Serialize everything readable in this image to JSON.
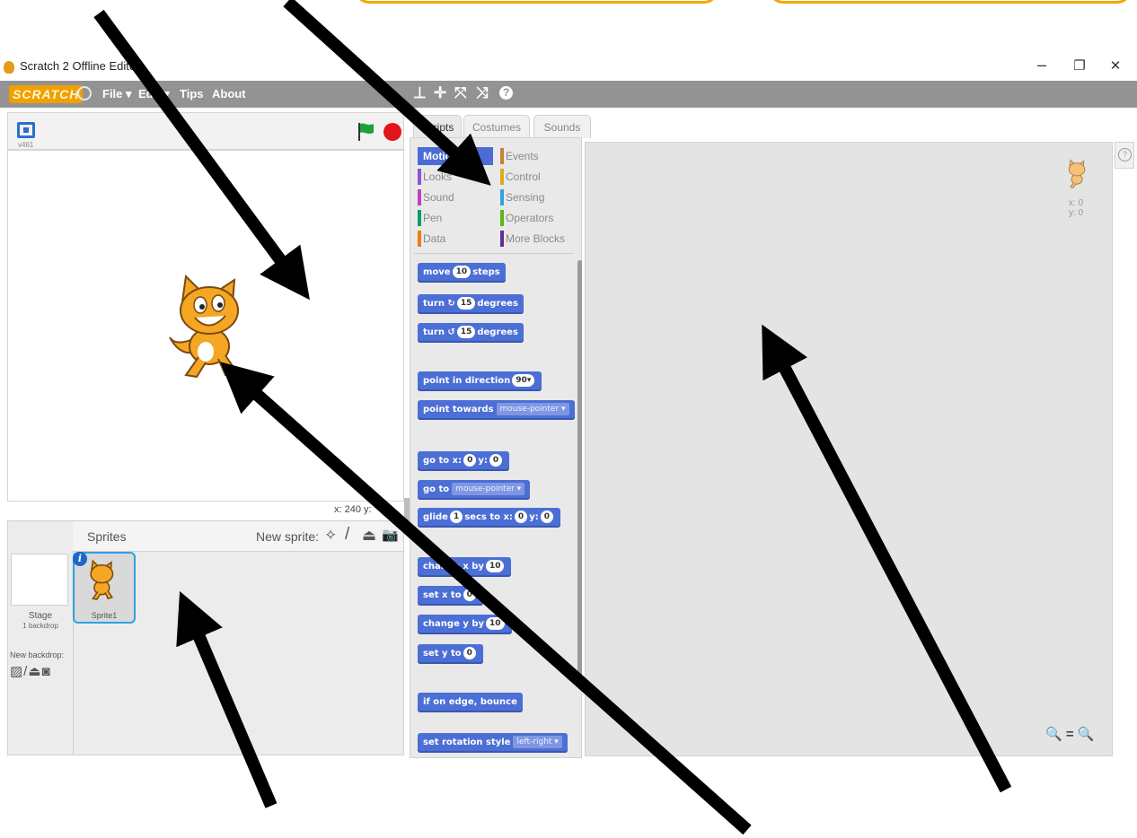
{
  "window": {
    "title": "Scratch 2 Offline Editor",
    "minimize_glyph": "–",
    "restore_glyph": "❐",
    "close_glyph": "✕"
  },
  "menubar": {
    "logo": "SCRATCH",
    "menus": [
      "File ▾",
      "Edit ▾",
      "Tips",
      "About"
    ],
    "tools": [
      "⊥",
      "✛",
      "⤧",
      "⤨",
      "?"
    ]
  },
  "stage": {
    "version": "v461",
    "coords": "x: 240  y:",
    "flag_color": "#1aa33a",
    "stop_color": "#e0161c"
  },
  "sprites_pane": {
    "title": "Sprites",
    "new_sprite_label": "New sprite:",
    "new_sprite_icons": [
      "✧",
      "/",
      "⏏",
      "📷"
    ],
    "stage_label": "Stage",
    "stage_sub": "1 backdrop",
    "new_backdrop_label": "New backdrop:",
    "backdrop_icons": "▨/⏏◙",
    "sprite_name": "Sprite1",
    "info_glyph": "i"
  },
  "tabs": [
    "Scripts",
    "Costumes",
    "Sounds"
  ],
  "categories": [
    {
      "label": "Motion",
      "color": "#4a6cd4"
    },
    {
      "label": "Events",
      "color": "#c88330"
    },
    {
      "label": "Looks",
      "color": "#8a55d7"
    },
    {
      "label": "Control",
      "color": "#e1a91a"
    },
    {
      "label": "Sound",
      "color": "#bb42c3"
    },
    {
      "label": "Sensing",
      "color": "#2ca5e2"
    },
    {
      "label": "Pen",
      "color": "#0e9a6c"
    },
    {
      "label": "Operators",
      "color": "#5cb712"
    },
    {
      "label": "Data",
      "color": "#ee7d16"
    },
    {
      "label": "More Blocks",
      "color": "#632d99"
    }
  ],
  "blocks": {
    "move": {
      "a": "move",
      "v": "10",
      "b": "steps"
    },
    "turn_right": {
      "a": "turn ↻",
      "v": "15",
      "b": "degrees"
    },
    "turn_left": {
      "a": "turn ↺",
      "v": "15",
      "b": "degrees"
    },
    "point_dir": {
      "a": "point in direction",
      "v": "90▾"
    },
    "point_towards": {
      "a": "point towards",
      "dd": "mouse-pointer ▾"
    },
    "goto_xy": {
      "a": "go to x:",
      "v1": "0",
      "b": "y:",
      "v2": "0"
    },
    "goto": {
      "a": "go to",
      "dd": "mouse-pointer ▾"
    },
    "glide": {
      "a": "glide",
      "v1": "1",
      "b": "secs to x:",
      "v2": "0",
      "c": "y:",
      "v3": "0"
    },
    "change_x": {
      "a": "change x by",
      "v": "10"
    },
    "set_x": {
      "a": "set x to",
      "v": "0"
    },
    "change_y": {
      "a": "change y by",
      "v": "10"
    },
    "set_y": {
      "a": "set y to",
      "v": "0"
    },
    "bounce": {
      "a": "if on edge, bounce"
    },
    "rotation": {
      "a": "set rotation style",
      "dd": "left-right ▾"
    }
  },
  "script_area": {
    "x": "x: 0",
    "y": "y: 0",
    "zoom": "🔍 = 🔍"
  },
  "help_glyph": "?"
}
